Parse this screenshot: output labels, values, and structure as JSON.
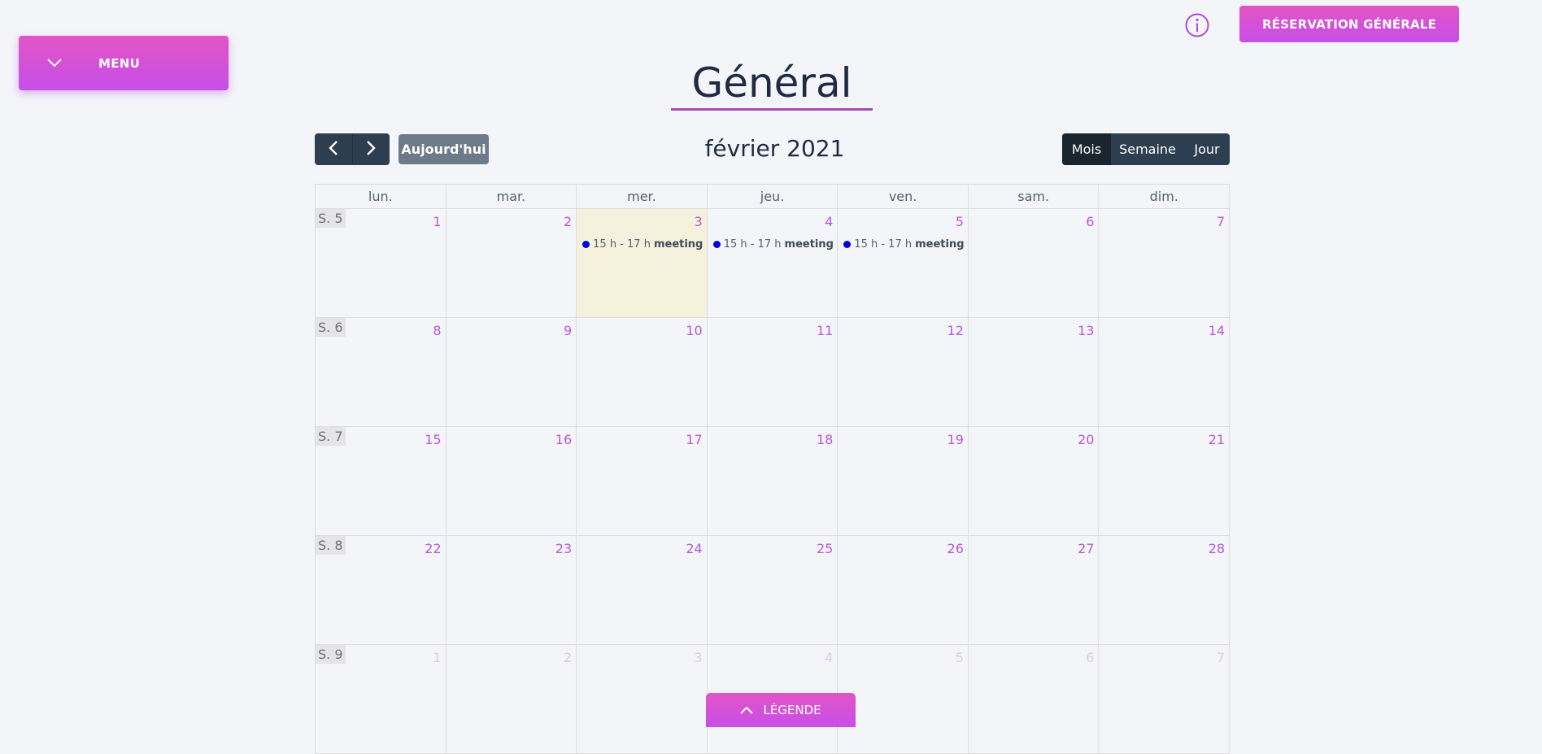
{
  "menu": {
    "label": "MENU",
    "icon": "chevron-down-icon"
  },
  "header": {
    "info_icon": "info-icon",
    "reservation_label": "RÉSERVATION GÉNÉRALE"
  },
  "page": {
    "title": "Général"
  },
  "toolbar": {
    "prev_icon": "chevron-left-icon",
    "next_icon": "chevron-right-icon",
    "today_label": "Aujourd'hui",
    "month_title": "février 2021",
    "views": [
      "Mois",
      "Semaine",
      "Jour"
    ],
    "active_view": "Mois"
  },
  "calendar": {
    "weekdays": [
      "lun.",
      "mar.",
      "mer.",
      "jeu.",
      "ven.",
      "sam.",
      "dim."
    ],
    "weeks": [
      {
        "label": "S. 5",
        "days": [
          "1",
          "2",
          "3",
          "4",
          "5",
          "6",
          "7"
        ]
      },
      {
        "label": "S. 6",
        "days": [
          "8",
          "9",
          "10",
          "11",
          "12",
          "13",
          "14"
        ]
      },
      {
        "label": "S. 7",
        "days": [
          "15",
          "16",
          "17",
          "18",
          "19",
          "20",
          "21"
        ]
      },
      {
        "label": "S. 8",
        "days": [
          "22",
          "23",
          "24",
          "25",
          "26",
          "27",
          "28"
        ]
      },
      {
        "label": "S. 9",
        "days": [
          "1",
          "2",
          "3",
          "4",
          "5",
          "6",
          "7"
        ]
      }
    ],
    "today": {
      "week": 0,
      "day": 2
    },
    "events": [
      {
        "week": 0,
        "day": 2,
        "time": "15 h - 17 h",
        "title": "meeting",
        "color": "#0000d6"
      },
      {
        "week": 0,
        "day": 3,
        "time": "15 h - 17 h",
        "title": "meeting",
        "color": "#0000d6"
      },
      {
        "week": 0,
        "day": 4,
        "time": "15 h - 17 h",
        "title": "meeting",
        "color": "#0000d6"
      }
    ]
  },
  "legend": {
    "label": "LÉGENDE",
    "icon": "chevron-up-icon"
  },
  "colors": {
    "accent": "#c74ee8",
    "accent_top": "#e255c5",
    "nav_dark": "#2c3e50",
    "today_bg": "#f6f1dc",
    "day_number": "#b658d3"
  }
}
